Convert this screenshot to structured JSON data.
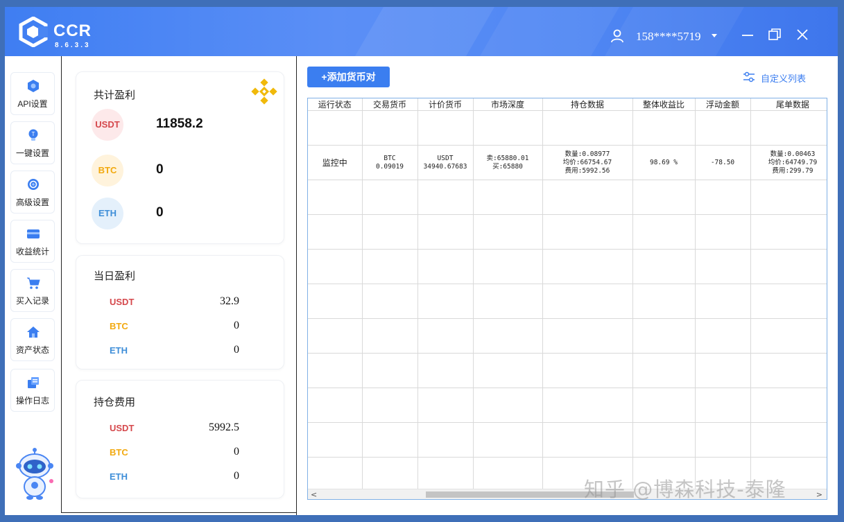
{
  "app": {
    "name": "CCR",
    "version": "8.6.3.3",
    "user": "158****5719"
  },
  "colors": {
    "titlebar": "#4a86f3",
    "accent": "#3b7ef0",
    "usdt": "#d5484c",
    "btc": "#f2a90f",
    "eth": "#3e8ed8",
    "binance_logo": "#f0b90b"
  },
  "nav": {
    "items": [
      {
        "label": "API设置",
        "icon": "api-icon"
      },
      {
        "label": "一键设置",
        "icon": "bulb-icon"
      },
      {
        "label": "高级设置",
        "icon": "settings-gear-icon"
      },
      {
        "label": "收益统计",
        "icon": "wallet-icon"
      },
      {
        "label": "买入记录",
        "icon": "cart-icon"
      },
      {
        "label": "资产状态",
        "icon": "home-icon"
      },
      {
        "label": "操作日志",
        "icon": "log-icon"
      }
    ]
  },
  "total_profit": {
    "title": "共计盈利",
    "rows": [
      {
        "coin": "USDT",
        "value": "11858.2"
      },
      {
        "coin": "BTC",
        "value": "0"
      },
      {
        "coin": "ETH",
        "value": "0"
      }
    ]
  },
  "daily_profit": {
    "title": "当日盈利",
    "rows": [
      {
        "coin": "USDT",
        "value": "32.9"
      },
      {
        "coin": "BTC",
        "value": "0"
      },
      {
        "coin": "ETH",
        "value": "0"
      }
    ]
  },
  "position_fee": {
    "title": "持仓费用",
    "rows": [
      {
        "coin": "USDT",
        "value": "5992.5"
      },
      {
        "coin": "BTC",
        "value": "0"
      },
      {
        "coin": "ETH",
        "value": "0"
      }
    ]
  },
  "toolbar": {
    "add_pair": "+添加货币对",
    "custom_list": "自定义列表"
  },
  "table": {
    "columns": [
      "运行状态",
      "交易货币",
      "计价货币",
      "市场深度",
      "持仓数据",
      "整体收益比",
      "浮动金额",
      "尾单数据"
    ],
    "row": {
      "status": "监控中",
      "trade": [
        "BTC",
        "0.09019"
      ],
      "quote": [
        "USDT",
        "34940.67683"
      ],
      "depth": [
        "卖:65880.01",
        "买:65880"
      ],
      "position": [
        "数量:0.08977",
        "均价:66754.67",
        "费用:5992.56"
      ],
      "ratio": "98.69 %",
      "floating": "-78.50",
      "tail": [
        "数量:0.00463",
        "均价:64749.79",
        "费用:299.79"
      ]
    }
  },
  "scrollbar": {
    "left_arrow": "<",
    "right_arrow": ">"
  },
  "watermark": "知乎 @博森科技-泰隆"
}
